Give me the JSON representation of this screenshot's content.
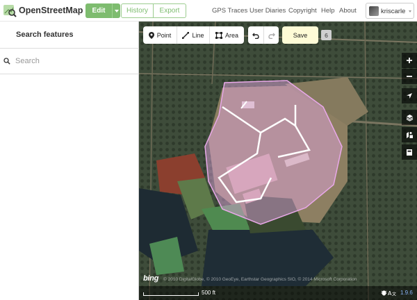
{
  "app": {
    "name": "OpenStreetMap"
  },
  "nav": {
    "edit_label": "Edit",
    "history_label": "History",
    "export_label": "Export",
    "links": [
      "GPS Traces",
      "User Diaries",
      "Copyright",
      "Help",
      "About"
    ],
    "user": {
      "name": "kriscarle"
    }
  },
  "sidebar": {
    "title": "Search features",
    "search_placeholder": "Search",
    "search_value": ""
  },
  "toolbar": {
    "point_label": "Point",
    "line_label": "Line",
    "area_label": "Area",
    "save_label": "Save",
    "edit_count": "6"
  },
  "map": {
    "scale_label": "500 ft",
    "attribution": "© 2010 DigitalGlobe, © 2010 GeoEye, Earthstar Geographics SIO, © 2014 Microsoft Corporation",
    "imagery_logo": "bing",
    "version": "1.9.6",
    "controls": [
      "zoom-in-icon",
      "zoom-out-icon",
      "geolocate-icon",
      "layers-icon",
      "map-data-icon",
      "help-icon"
    ]
  },
  "colors": {
    "brand_green": "#7ebc6f",
    "save_bg": "#fefbd6",
    "area_fill": "#e8a8e8",
    "way_white": "#ffffff"
  }
}
